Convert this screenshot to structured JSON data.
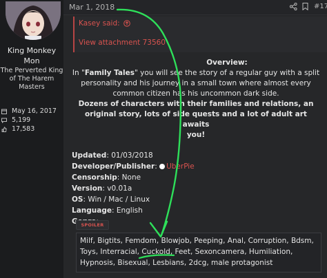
{
  "user": {
    "name_line1": "King Monkey",
    "name_line2": "Mon",
    "title_lines": [
      "The Perverted King",
      "of The Harem",
      "Masters"
    ],
    "stats": [
      {
        "icon": "calendar-icon",
        "value": "May 16, 2017"
      },
      {
        "icon": "messages-icon",
        "value": "5,199"
      },
      {
        "icon": "reaction-icon",
        "value": "17,583"
      }
    ]
  },
  "post": {
    "date": "Mar 1, 2018",
    "number": "#17"
  },
  "quote": {
    "author": "Kasey said:",
    "attachment": "View attachment 73560"
  },
  "content": {
    "overview_heading": "Overview:",
    "para1_prefix": "In \"",
    "para1_bold": "Family Tales",
    "para1_line1_rest": "\" you will see the story of a regular guy with a split",
    "para1_line2": "personality and his journey in a small town where almost every",
    "para1_line3": "common citizen has his uncommon dark side.",
    "para2_line1": "Dozens of characters with their families and relations, an",
    "para2_line2": "original story, lots of side quests and a lot of adult art awaits",
    "para2_line3": "you!",
    "details": [
      {
        "label": "Updated",
        "value": ": 01/03/2018"
      },
      {
        "label": "Developer/Publisher",
        "value": ": "
      },
      {
        "label": "Censorship",
        "value": ": None"
      },
      {
        "label": "Version",
        "value": ": v0.01a"
      },
      {
        "label": "OS",
        "value": ": Win / Mac / Linux"
      },
      {
        "label": "Language",
        "value": ": English"
      },
      {
        "label": "Genre",
        "value": ":"
      }
    ],
    "publisher_link": "UberPie"
  },
  "spoiler": {
    "button_label": "SPOILER",
    "lines": [
      "Milf, Bigtits, Femdom, Blowjob, Peeping, Anal, Corruption, Bdsm,",
      "Toys, Interracial, Cuckold, Feet, Sexoncamera, Humiliation,",
      "Hypnosis, Bisexual, Lesbians, 2dcg, male protagonist"
    ]
  },
  "colors": {
    "accent": "#d9534f",
    "background": "#262729",
    "annotation": "#2ee05a"
  }
}
